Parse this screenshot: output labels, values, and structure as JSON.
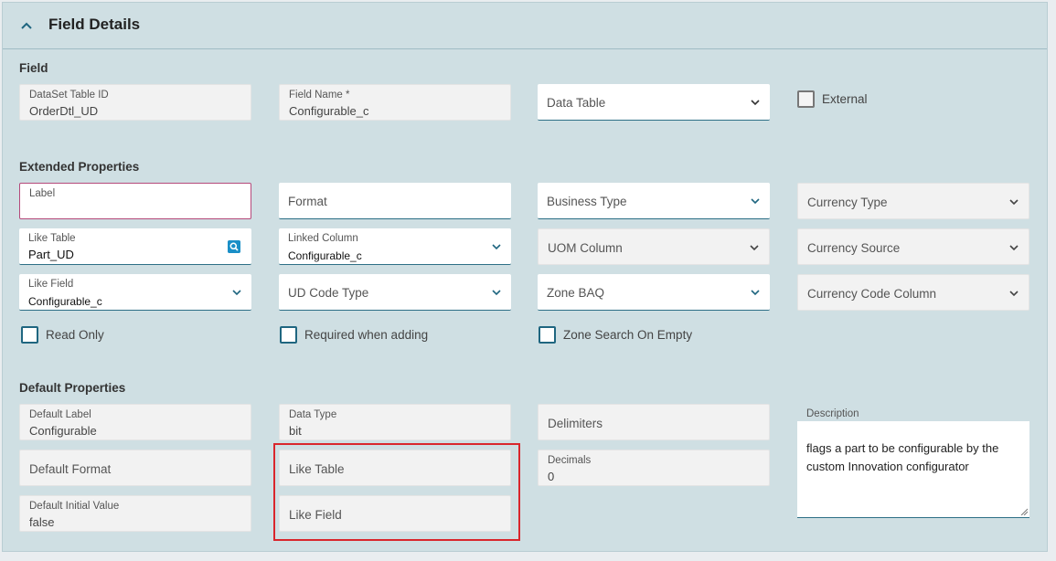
{
  "panel": {
    "title": "Field Details"
  },
  "sections": {
    "field": "Field",
    "extended": "Extended Properties",
    "default": "Default Properties"
  },
  "field": {
    "dataset_table_id": {
      "label": "DataSet Table ID",
      "value": "OrderDtl_UD"
    },
    "field_name": {
      "label": "Field Name *",
      "value": "Configurable_c"
    },
    "data_table": {
      "placeholder": "Data Table"
    },
    "external": {
      "label": "External",
      "checked": false
    }
  },
  "extended": {
    "label": {
      "label": "Label",
      "value": ""
    },
    "format": {
      "placeholder": "Format"
    },
    "business_type": {
      "placeholder": "Business Type"
    },
    "currency_type": {
      "placeholder": "Currency Type"
    },
    "like_table": {
      "label": "Like Table",
      "value": "Part_UD"
    },
    "linked_column": {
      "label": "Linked Column",
      "value": "Configurable_c"
    },
    "uom_column": {
      "placeholder": "UOM Column"
    },
    "currency_source": {
      "placeholder": "Currency Source"
    },
    "like_field": {
      "label": "Like Field",
      "value": "Configurable_c"
    },
    "ud_code_type": {
      "placeholder": "UD Code Type"
    },
    "zone_baq": {
      "placeholder": "Zone BAQ"
    },
    "currency_code_column": {
      "placeholder": "Currency Code Column"
    },
    "read_only": {
      "label": "Read Only",
      "checked": false
    },
    "required_when_adding": {
      "label": "Required when adding",
      "checked": false
    },
    "zone_search_on_empty": {
      "label": "Zone Search On Empty",
      "checked": false
    }
  },
  "default": {
    "default_label": {
      "label": "Default Label",
      "value": "Configurable"
    },
    "data_type": {
      "label": "Data Type",
      "value": "bit"
    },
    "delimiters": {
      "placeholder": "Delimiters"
    },
    "default_format": {
      "placeholder": "Default Format"
    },
    "like_table": {
      "placeholder": "Like Table"
    },
    "decimals": {
      "label": "Decimals",
      "value": "0"
    },
    "default_initial_value": {
      "label": "Default Initial Value",
      "value": "false"
    },
    "like_field": {
      "placeholder": "Like Field"
    },
    "description": {
      "label": "Description",
      "value": "flags a part to be configurable by the custom Innovation configurator"
    }
  },
  "colors": {
    "panel_bg": "#cfdfe3",
    "accent": "#2d6f86",
    "highlight": "#d9262c"
  }
}
